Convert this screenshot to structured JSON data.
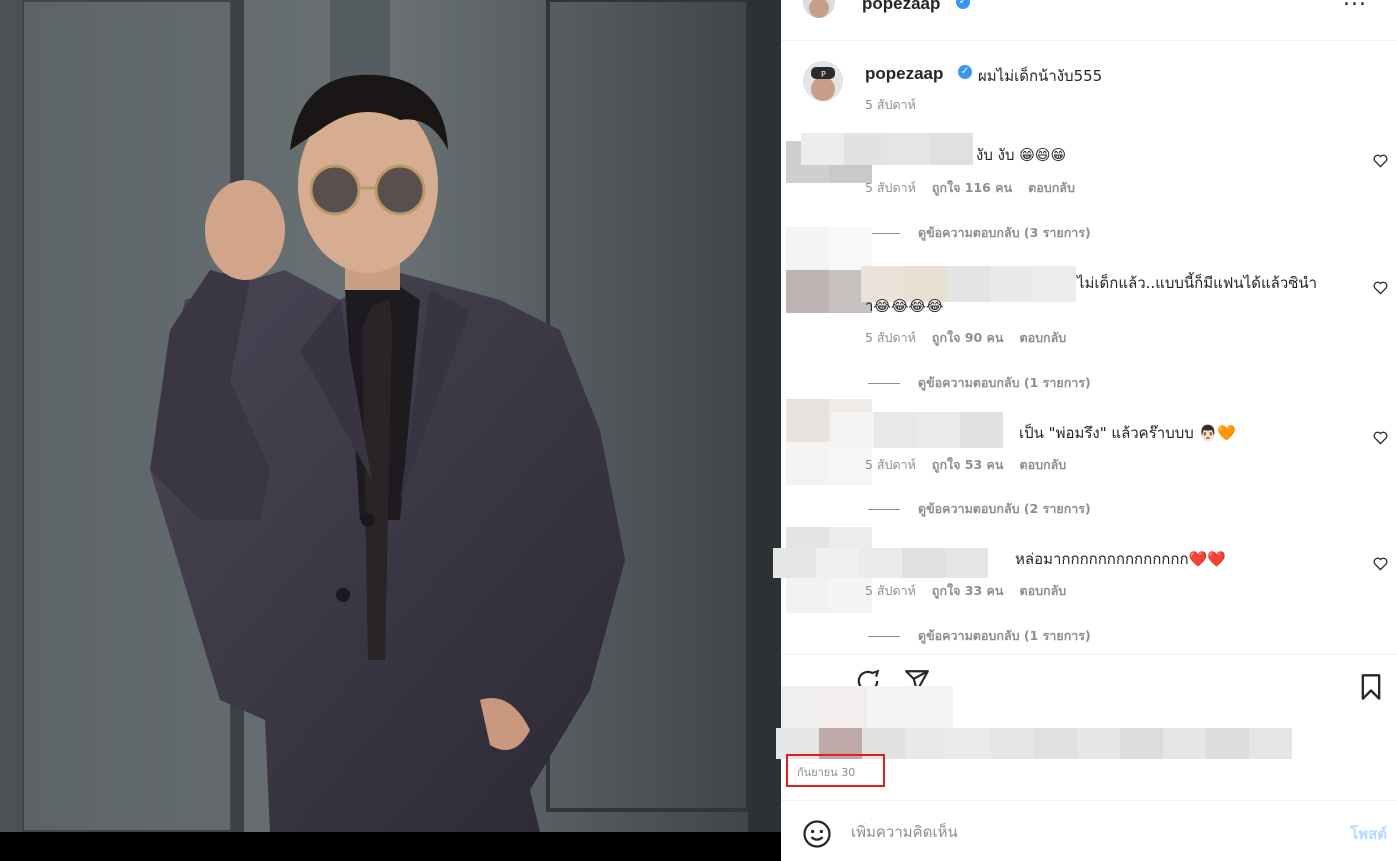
{
  "post": {
    "username": "popezaap",
    "verified_icon": "verified-badge-icon",
    "more_icon": "more-options-icon",
    "more_label": "..."
  },
  "caption": {
    "username": "popezaap",
    "text": "ผมไม่เด็กน้างับ555",
    "time": "5 สัปดาห์"
  },
  "comments": [
    {
      "text": "งับ งับ 😁😄😁",
      "time": "5 สัปดาห์",
      "likes": "ถูกใจ 116 คน",
      "reply": "ตอบกลับ",
      "view_replies": "ดูข้อความตอบกลับ (3 รายการ)"
    },
    {
      "text": "ไม่เด็กแล้ว..แบบนี้ก็มีแฟนได้แล้วซินำ",
      "text2": "า😂😂😂😂",
      "time": "5 สัปดาห์",
      "likes": "ถูกใจ 90 คน",
      "reply": "ตอบกลับ",
      "view_replies": "ดูข้อความตอบกลับ (1 รายการ)"
    },
    {
      "text": "เป็น \"พ่อมรึง\" แล้วคร๊าบบบ 👨🏻🧡",
      "time": "5 สัปดาห์",
      "likes": "ถูกใจ 53 คน",
      "reply": "ตอบกลับ",
      "view_replies": "ดูข้อความตอบกลับ (2 รายการ)"
    },
    {
      "text": "หล่อมากกกกกกกกกกกกกก❤️❤️",
      "time": "5 สัปดาห์",
      "likes": "ถูกใจ 33 คน",
      "reply": "ตอบกลับ",
      "view_replies": "ดูข้อความตอบกลับ (1 รายการ)"
    }
  ],
  "actions": {
    "comment_icon": "comment-icon",
    "share_icon": "share-icon",
    "save_icon": "bookmark-icon"
  },
  "date": "กันยายน 30",
  "add_comment": {
    "emoji_icon": "emoji-icon",
    "placeholder": "เพิ่มความคิดเห็น",
    "post_label": "โพสต์"
  },
  "colors": {
    "accent": "#3897f0",
    "post_disabled": "#b3dbff",
    "highlight": "#e02020",
    "heart_outline": "#262626"
  }
}
